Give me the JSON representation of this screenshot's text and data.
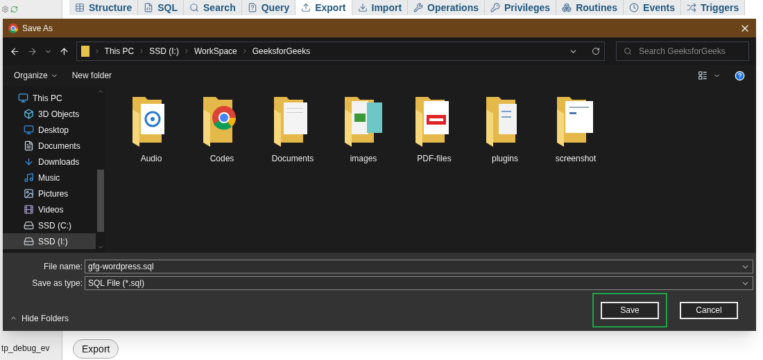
{
  "background": {
    "tabs": [
      {
        "label": "Structure",
        "kind": "structure",
        "selected": false
      },
      {
        "label": "SQL",
        "kind": "sql",
        "selected": false
      },
      {
        "label": "Search",
        "kind": "search",
        "selected": false
      },
      {
        "label": "Query",
        "kind": "query",
        "selected": false
      },
      {
        "label": "Export",
        "kind": "export",
        "selected": true
      },
      {
        "label": "Import",
        "kind": "import",
        "selected": false
      },
      {
        "label": "Operations",
        "kind": "operations",
        "selected": false
      },
      {
        "label": "Privileges",
        "kind": "privileges",
        "selected": false
      },
      {
        "label": "Routines",
        "kind": "routines",
        "selected": false
      },
      {
        "label": "Events",
        "kind": "events",
        "selected": false
      },
      {
        "label": "Triggers",
        "kind": "triggers",
        "selected": false
      }
    ],
    "sidebar_text": "tp_debug_ev",
    "export_button": "Export"
  },
  "dialog": {
    "title": "Save As",
    "breadcrumb": [
      "This PC",
      "SSD (I:)",
      "WorkSpace",
      "GeeksforGeeks"
    ],
    "search": {
      "placeholder": "Search GeeksforGeeks"
    },
    "toolbar": {
      "organize": "Organize",
      "new_folder": "New folder"
    },
    "nav_tree": [
      {
        "label": "This PC",
        "kind": "computer",
        "selected": false,
        "children": [
          {
            "label": "3D Objects",
            "kind": "cube",
            "selected": false
          },
          {
            "label": "Desktop",
            "kind": "desktop",
            "selected": false
          },
          {
            "label": "Documents",
            "kind": "document",
            "selected": false
          },
          {
            "label": "Downloads",
            "kind": "download",
            "selected": false
          },
          {
            "label": "Music",
            "kind": "music",
            "selected": false
          },
          {
            "label": "Pictures",
            "kind": "picture",
            "selected": false
          },
          {
            "label": "Videos",
            "kind": "video",
            "selected": false
          },
          {
            "label": "SSD (C:)",
            "kind": "drive",
            "selected": false
          },
          {
            "label": "SSD (I:)",
            "kind": "drive",
            "selected": true
          }
        ]
      }
    ],
    "folders": [
      {
        "name": "Audio",
        "kind": "audio"
      },
      {
        "name": "Codes",
        "kind": "chrome"
      },
      {
        "name": "Documents",
        "kind": "document"
      },
      {
        "name": "images",
        "kind": "image"
      },
      {
        "name": "PDF-files",
        "kind": "pdf"
      },
      {
        "name": "plugins",
        "kind": "plugins"
      },
      {
        "name": "screenshot",
        "kind": "screenshot"
      }
    ],
    "file_name": {
      "label": "File name:",
      "value": "gfg-wordpress.sql"
    },
    "save_type": {
      "label": "Save as type:",
      "value": "SQL File (*.sql)"
    },
    "hide_folders": "Hide Folders",
    "buttons": [
      {
        "label": "Save",
        "highlighted": true
      },
      {
        "label": "Cancel",
        "highlighted": false
      }
    ]
  }
}
